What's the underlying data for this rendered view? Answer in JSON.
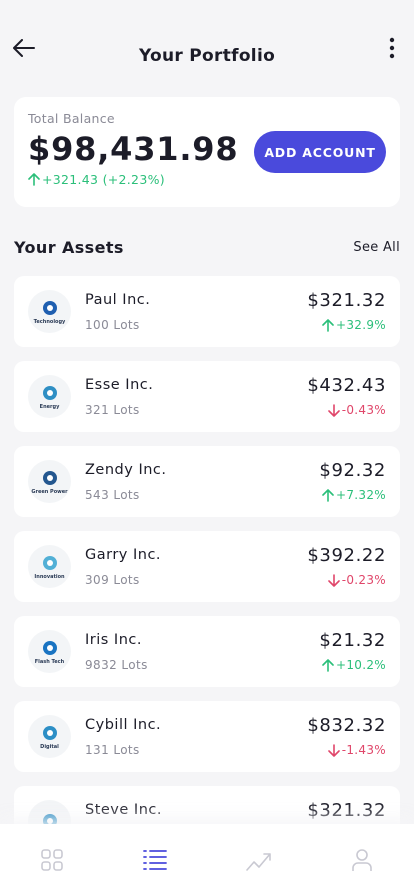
{
  "header": {
    "title": "Your Portfolio"
  },
  "balance": {
    "label": "Total Balance",
    "amount": "$98,431.98",
    "change": "+321.43 (+2.23%)",
    "add_button": "ADD ACCOUNT"
  },
  "assets_section": {
    "title": "Your Assets",
    "see_all": "See All"
  },
  "assets": [
    {
      "name": "Paul Inc.",
      "lots": "100 Lots",
      "price": "$321.32",
      "change": "+32.9%",
      "direction": "up",
      "logo_caption": "Technology",
      "logo_color": "#1f5fb0"
    },
    {
      "name": "Esse Inc.",
      "lots": "321 Lots",
      "price": "$432.43",
      "change": "-0.43%",
      "direction": "down",
      "logo_caption": "Energy",
      "logo_color": "#2f8fc4"
    },
    {
      "name": "Zendy Inc.",
      "lots": "543 Lots",
      "price": "$92.32",
      "change": "+7.32%",
      "direction": "up",
      "logo_caption": "Green Power",
      "logo_color": "#24578f"
    },
    {
      "name": "Garry Inc.",
      "lots": "309 Lots",
      "price": "$392.22",
      "change": "-0.23%",
      "direction": "down",
      "logo_caption": "Innovation",
      "logo_color": "#52b0d6"
    },
    {
      "name": "Iris Inc.",
      "lots": "9832 Lots",
      "price": "$21.32",
      "change": "+10.2%",
      "direction": "up",
      "logo_caption": "Flash Tech",
      "logo_color": "#1a74c2"
    },
    {
      "name": "Cybill Inc.",
      "lots": "131 Lots",
      "price": "$832.32",
      "change": "-1.43%",
      "direction": "down",
      "logo_caption": "Digital",
      "logo_color": "#2d8fc6"
    },
    {
      "name": "Steve Inc.",
      "lots": "",
      "price": "$321.32",
      "change": "",
      "direction": "",
      "logo_caption": "",
      "logo_color": "#2f8fc4"
    }
  ],
  "colors": {
    "accent": "#4a4adc",
    "up": "#2bbf7a",
    "down": "#e0466a"
  },
  "tabs": [
    {
      "icon": "grid-icon",
      "active": false
    },
    {
      "icon": "list-icon",
      "active": true
    },
    {
      "icon": "trend-icon",
      "active": false
    },
    {
      "icon": "user-icon",
      "active": false
    }
  ]
}
